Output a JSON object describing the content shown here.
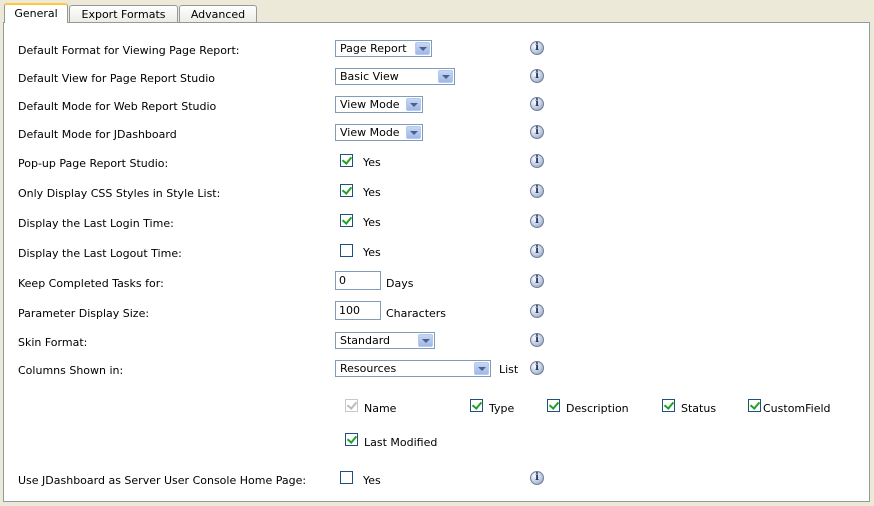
{
  "tabs": [
    "General",
    "Export Formats",
    "Advanced"
  ],
  "info_glyph": "i",
  "rows": {
    "default_format": {
      "label": "Default Format for Viewing Page Report:",
      "value": "Page Report"
    },
    "default_view": {
      "label": "Default View for Page Report Studio",
      "value": "Basic View"
    },
    "mode_web": {
      "label": "Default Mode for Web Report Studio",
      "value": "View Mode"
    },
    "mode_jdash": {
      "label": "Default Mode for JDashboard",
      "value": "View Mode"
    },
    "popup": {
      "label": "Pop-up Page Report Studio:",
      "checked": true,
      "text": "Yes"
    },
    "css_only": {
      "label": "Only Display CSS Styles in Style List:",
      "checked": true,
      "text": "Yes"
    },
    "last_login": {
      "label": "Display the Last Login Time:",
      "checked": true,
      "text": "Yes"
    },
    "last_logout": {
      "label": "Display the Last Logout Time:",
      "checked": false,
      "text": "Yes"
    },
    "keep_tasks": {
      "label": "Keep Completed Tasks for:",
      "value": "0",
      "unit": "Days"
    },
    "param_size": {
      "label": "Parameter Display Size:",
      "value": "100",
      "unit": "Characters"
    },
    "skin": {
      "label": "Skin Format:",
      "value": "Standard"
    },
    "columns": {
      "label": "Columns Shown in:",
      "value": "Resources",
      "suffix": "List"
    },
    "jdash_home": {
      "label": "Use JDashboard as Server User Console Home Page:",
      "checked": false,
      "text": "Yes"
    }
  },
  "column_options": {
    "name": {
      "label": "Name",
      "checked": true,
      "disabled": true
    },
    "type": {
      "label": "Type",
      "checked": true
    },
    "description": {
      "label": "Description",
      "checked": true
    },
    "status": {
      "label": "Status",
      "checked": true
    },
    "customfield": {
      "label": "CustomField",
      "checked": true
    },
    "last_modified": {
      "label": "Last Modified",
      "checked": true
    }
  }
}
